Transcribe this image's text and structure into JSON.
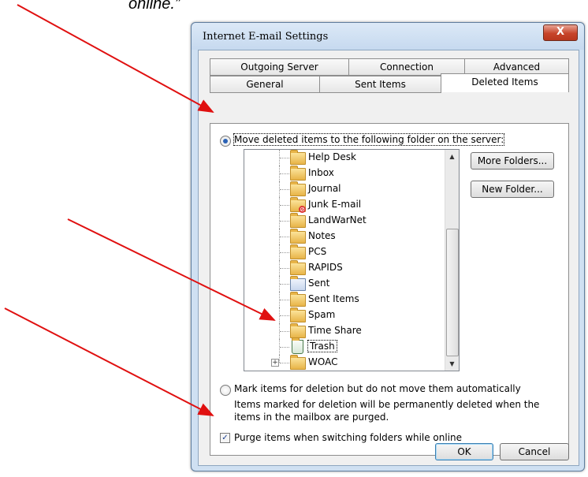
{
  "caption": "online.”",
  "dialog": {
    "title": "Internet E-mail Settings",
    "close_glyph": "X",
    "tabs_row1": [
      "Outgoing Server",
      "Connection",
      "Advanced"
    ],
    "tabs_row2": [
      "General",
      "Sent Items",
      "Deleted Items"
    ],
    "active_tab": "Deleted Items"
  },
  "deleted_items": {
    "move_option": "Move deleted items to the following folder on the server:",
    "move_selected": true,
    "folders": [
      {
        "label": "Help Desk",
        "icon": "folder-icon"
      },
      {
        "label": "Inbox",
        "icon": "inbox-folder-icon"
      },
      {
        "label": "Journal",
        "icon": "folder-icon"
      },
      {
        "label": "Junk E-mail",
        "icon": "junk-folder-icon"
      },
      {
        "label": "LandWarNet",
        "icon": "folder-icon"
      },
      {
        "label": "Notes",
        "icon": "folder-icon"
      },
      {
        "label": "PCS",
        "icon": "folder-icon"
      },
      {
        "label": "RAPIDS",
        "icon": "folder-icon"
      },
      {
        "label": "Sent",
        "icon": "sent-folder-icon"
      },
      {
        "label": "Sent Items",
        "icon": "folder-icon"
      },
      {
        "label": "Spam",
        "icon": "folder-icon"
      },
      {
        "label": "Time Share",
        "icon": "folder-icon"
      },
      {
        "label": "Trash",
        "icon": "trash-icon"
      },
      {
        "label": "WOAC",
        "icon": "folder-icon",
        "expandable": true
      }
    ],
    "more_folders_button": "More Folders...",
    "new_folder_button": "New Folder...",
    "mark_option": "Mark items for deletion but do not move them automatically",
    "mark_note": "Items marked for deletion will be permanently deleted when the items in the mailbox are purged.",
    "purge_option": "Purge items when switching folders while online",
    "purge_checked": true
  },
  "footer": {
    "ok_label": "OK",
    "cancel_label": "Cancel"
  },
  "colors": {
    "arrow": "#e01010",
    "radio_dot": "#2b62b5",
    "title_bar": "#c6d9ef"
  }
}
